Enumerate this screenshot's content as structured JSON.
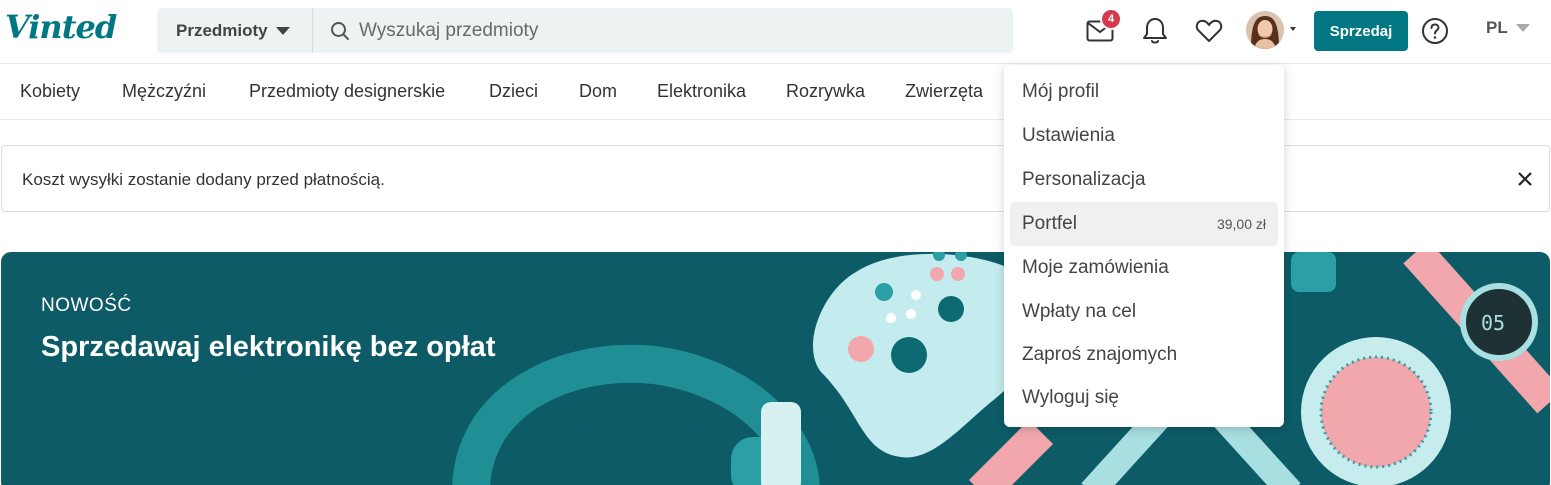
{
  "header": {
    "logo": "Vinted",
    "category_select": "Przedmioty",
    "search_placeholder": "Wyszukaj przedmioty",
    "inbox_badge": "4",
    "sell_label": "Sprzedaj",
    "language": "PL",
    "icons": [
      "envelope-icon",
      "bell-icon",
      "heart-icon",
      "help-icon"
    ]
  },
  "catnav": {
    "items": [
      "Kobiety",
      "Mężczyźni",
      "Przedmioty designerskie",
      "Dzieci",
      "Dom",
      "Elektronika",
      "Rozrywka",
      "Zwierzęta"
    ]
  },
  "notice": {
    "text": "Koszt wysyłki zostanie dodany przed płatnością."
  },
  "hero": {
    "kicker": "NOWOŚĆ",
    "title": "Sprzedawaj elektronikę bez opłat"
  },
  "menu": {
    "items": [
      {
        "label": "Mój profil"
      },
      {
        "label": "Ustawienia"
      },
      {
        "label": "Personalizacja"
      },
      {
        "label": "Portfel",
        "value": "39,00 zł"
      },
      {
        "label": "Moje zamówienia"
      },
      {
        "label": "Wpłaty na cel"
      },
      {
        "label": "Zaproś znajomych"
      },
      {
        "label": "Wyloguj się"
      }
    ]
  },
  "colors": {
    "brand": "#007782",
    "badge": "#d6394c",
    "hero_bg": "#0c5b67"
  }
}
